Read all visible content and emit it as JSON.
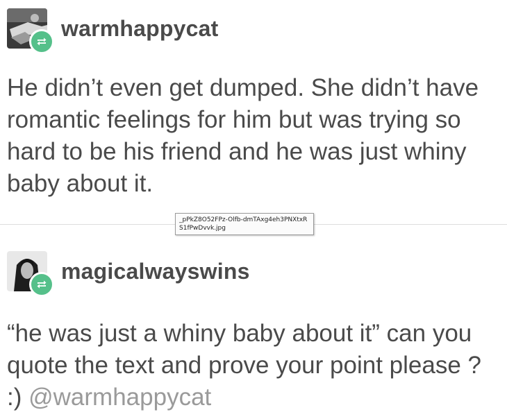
{
  "posts": [
    {
      "username": "warmhappycat",
      "body": "He didn’t even get dumped.  She didn’t have romantic feelings for him but was trying so hard to be his friend and he was just whiny baby about it."
    },
    {
      "username": "magicalwayswins",
      "body": "“he was just a whiny baby about it” can you quote the text and prove your point please ? :)",
      "mention": "@warmhappycat"
    }
  ],
  "tooltip": {
    "text": "_pPkZ8O52FPz-Olfb-dmTAxg4eh3PNXtxRS1fPwDvvk.jpg"
  },
  "icons": {
    "reblog": "reblog-icon"
  },
  "colors": {
    "text": "#4a4a4a",
    "mention": "#9a9a9a",
    "reblog_badge": "#55c08a"
  }
}
